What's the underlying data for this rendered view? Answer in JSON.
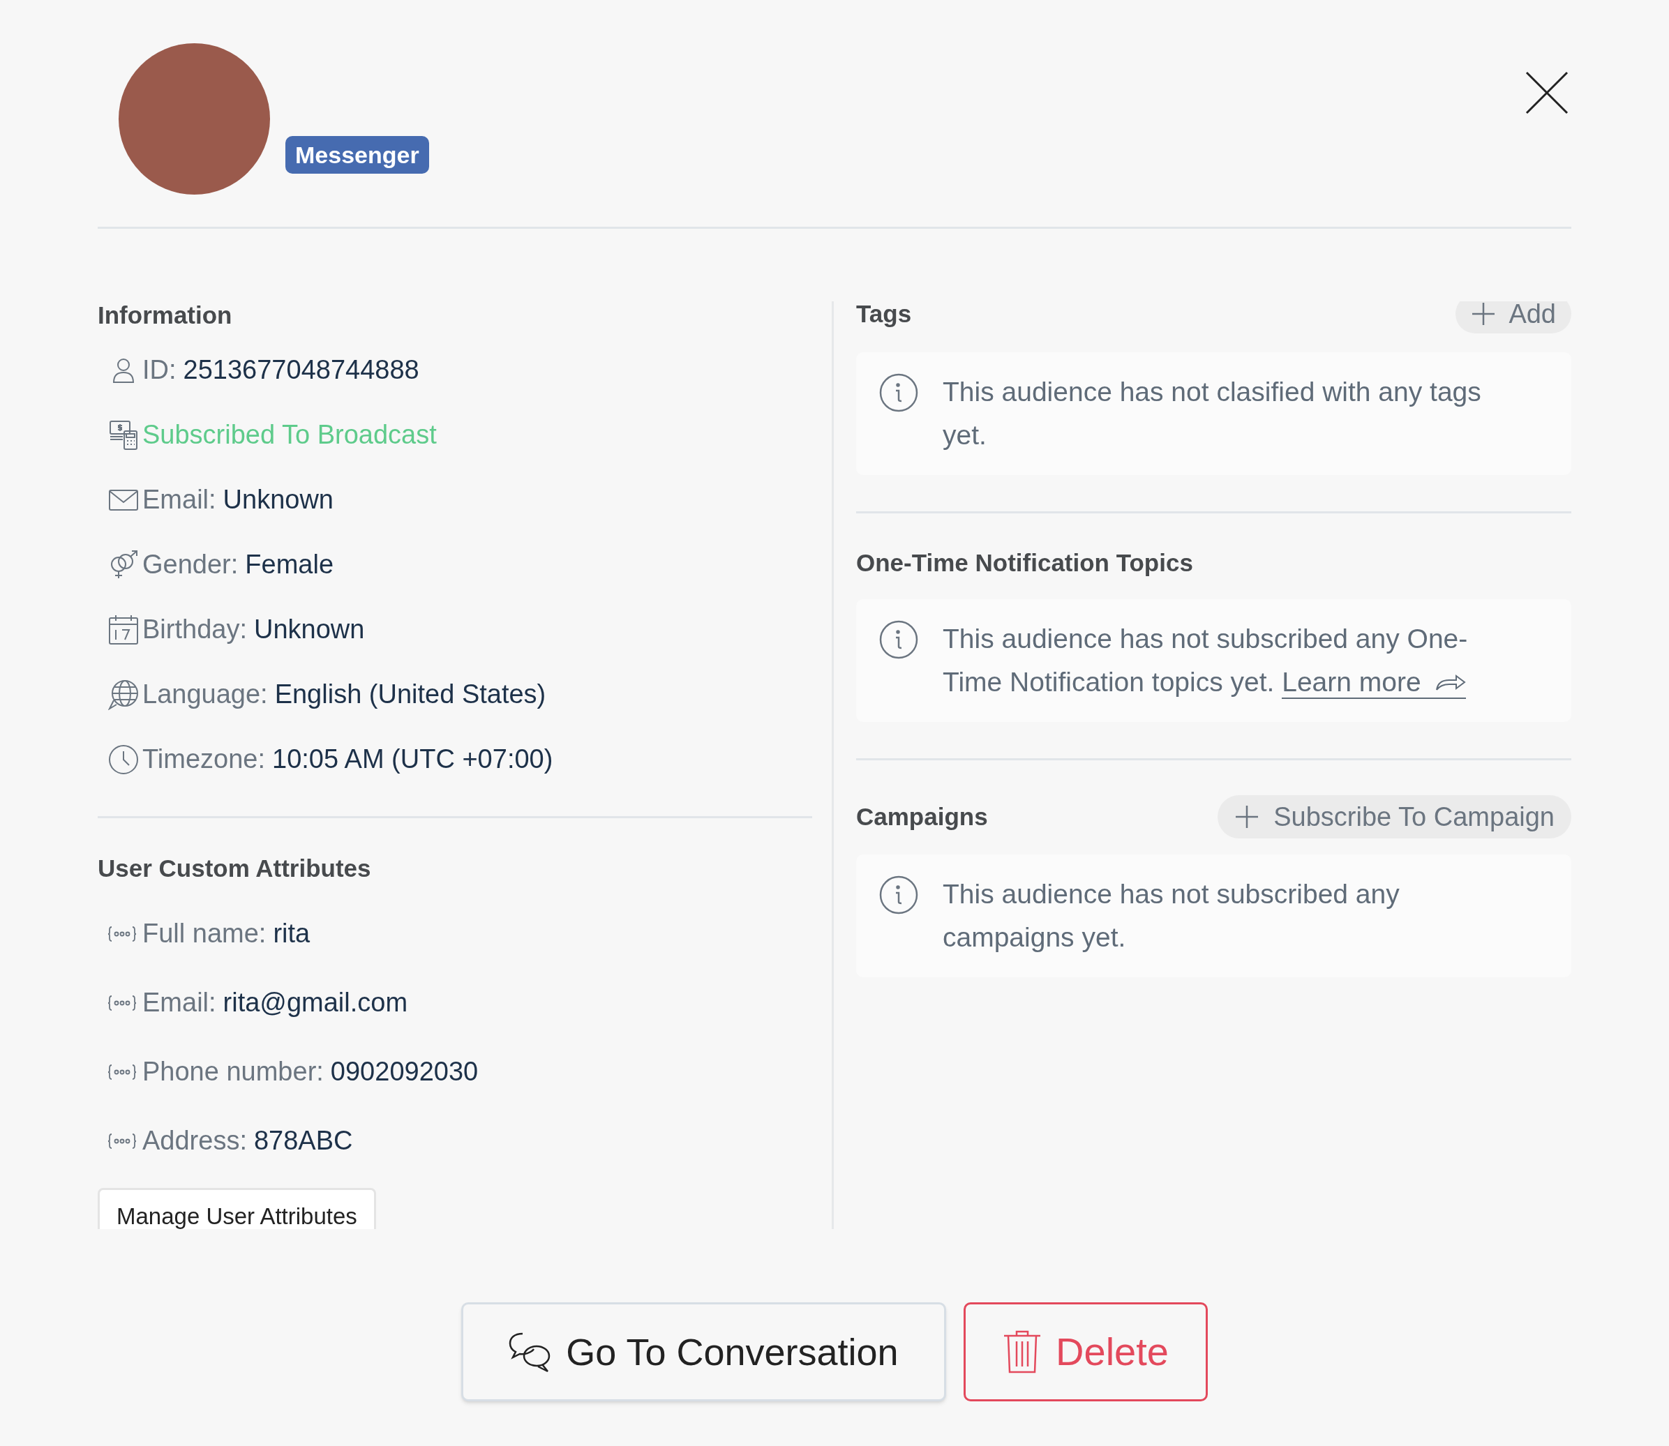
{
  "profile": {
    "channel_badge": "Messenger"
  },
  "information": {
    "title": "Information",
    "rows": [
      {
        "kind": "id",
        "label": "ID:",
        "value": "2513677048744888"
      },
      {
        "kind": "subscription",
        "text": "Subscribed To Broadcast"
      },
      {
        "kind": "email",
        "label": "Email:",
        "value": "Unknown"
      },
      {
        "kind": "gender",
        "label": "Gender:",
        "value": "Female"
      },
      {
        "kind": "birthday",
        "label": "Birthday:",
        "value": "Unknown"
      },
      {
        "kind": "language",
        "label": "Language:",
        "value": "English (United States)"
      },
      {
        "kind": "timezone",
        "label": "Timezone:",
        "value": "10:05 AM (UTC +07:00)"
      }
    ]
  },
  "custom_attributes": {
    "title": "User Custom Attributes",
    "rows": [
      {
        "label": "Full name:",
        "value": "rita"
      },
      {
        "label": "Email:",
        "value": "rita@gmail.com"
      },
      {
        "label": "Phone number:",
        "value": "0902092030"
      },
      {
        "label": "Address:",
        "value": "878ABC"
      }
    ],
    "manage_button": "Manage User Attributes"
  },
  "tags": {
    "title": "Tags",
    "add_button": "Add",
    "empty_message": "This audience has not clasified with any tags yet."
  },
  "notification_topics": {
    "title": "One-Time Notification Topics",
    "message": "This audience has not subscribed any One-Time Notification topics yet.",
    "link": "Learn more"
  },
  "campaigns": {
    "title": "Campaigns",
    "subscribe_button": "Subscribe To Campaign",
    "empty_message": "This audience has not subscribed any campaigns yet."
  },
  "footer": {
    "conversation_button": "Go To Conversation",
    "delete_button": "Delete"
  }
}
